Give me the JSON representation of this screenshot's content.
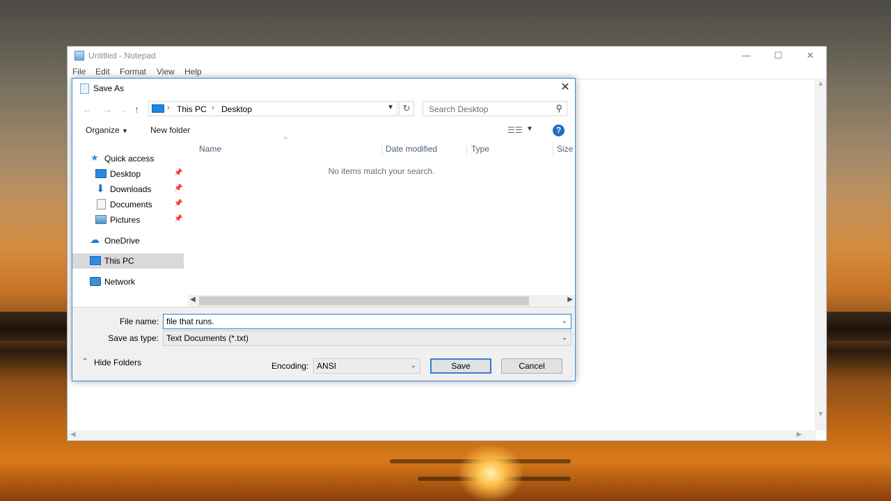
{
  "notepad": {
    "title": "Untitled - Notepad",
    "menu": [
      "File",
      "Edit",
      "Format",
      "View",
      "Help"
    ],
    "controls": {
      "minimize": "—",
      "maximize": "☐",
      "close": "✕"
    }
  },
  "dialog": {
    "title": "Save As",
    "address": {
      "crumbs": [
        "This PC",
        "Desktop"
      ]
    },
    "search": {
      "placeholder": "Search Desktop"
    },
    "toolbar": {
      "organize": "Organize",
      "new_folder": "New folder",
      "help": "?"
    },
    "nav_items": [
      {
        "label": "Quick access",
        "icon": "star-icon"
      },
      {
        "label": "Desktop",
        "icon": "desktop-folder-icon",
        "pinned": true
      },
      {
        "label": "Downloads",
        "icon": "download-arrow-icon",
        "pinned": true
      },
      {
        "label": "Documents",
        "icon": "document-icon",
        "pinned": true
      },
      {
        "label": "Pictures",
        "icon": "picture-icon",
        "pinned": true
      },
      {
        "label": "OneDrive",
        "icon": "cloud-icon"
      },
      {
        "label": "This PC",
        "icon": "computer-icon",
        "selected": true
      },
      {
        "label": "Network",
        "icon": "network-icon"
      }
    ],
    "columns": [
      "Name",
      "Date modified",
      "Type",
      "Size"
    ],
    "empty_message": "No items match your search.",
    "file_name": {
      "label": "File name:",
      "value": "file that runs."
    },
    "save_as_type": {
      "label": "Save as type:",
      "value": "Text Documents (*.txt)"
    },
    "encoding": {
      "label": "Encoding:",
      "value": "ANSI"
    },
    "hide_folders": "Hide Folders",
    "buttons": {
      "save": "Save",
      "cancel": "Cancel"
    }
  },
  "colors": {
    "accent": "#2f7fd1",
    "selection": "#d9d9d9"
  }
}
